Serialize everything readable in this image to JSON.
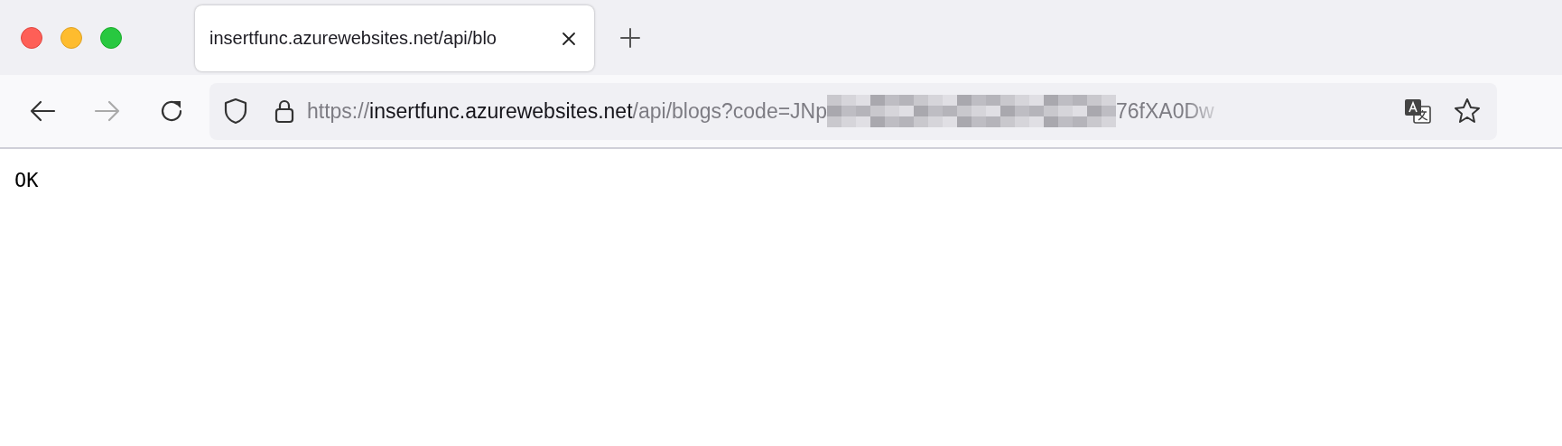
{
  "tab": {
    "title": "insertfunc.azurewebsites.net/api/blo"
  },
  "address_bar": {
    "scheme": "https://",
    "host": "insertfunc.azurewebsites.net",
    "path": "/api/blogs?code=JNp",
    "path_end": "76fXA0Dw"
  },
  "page": {
    "body_text": "OK"
  }
}
